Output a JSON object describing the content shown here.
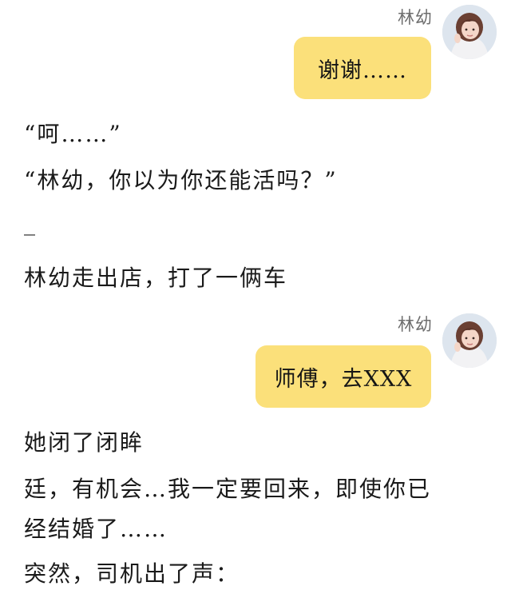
{
  "messages": [
    {
      "sender": "林幼",
      "text": "谢谢……"
    },
    {
      "sender": "林幼",
      "text": "师傅，去XXX"
    }
  ],
  "story": {
    "line1": "“呵……”",
    "line2": "“林幼，你以为你还能活吗？”",
    "line3": "_",
    "line4": "林幼走出店，打了一俩车",
    "line5": "她闭了闭眸",
    "line6": "廷，有机会…我一定要回来，即使你已",
    "line7": "经结婚了……",
    "line8": "突然，司机出了声："
  },
  "colors": {
    "bubble": "#fbe07a",
    "name": "#6d6d6d",
    "text": "#1a1a1a"
  },
  "icons": [
    "avatar"
  ]
}
